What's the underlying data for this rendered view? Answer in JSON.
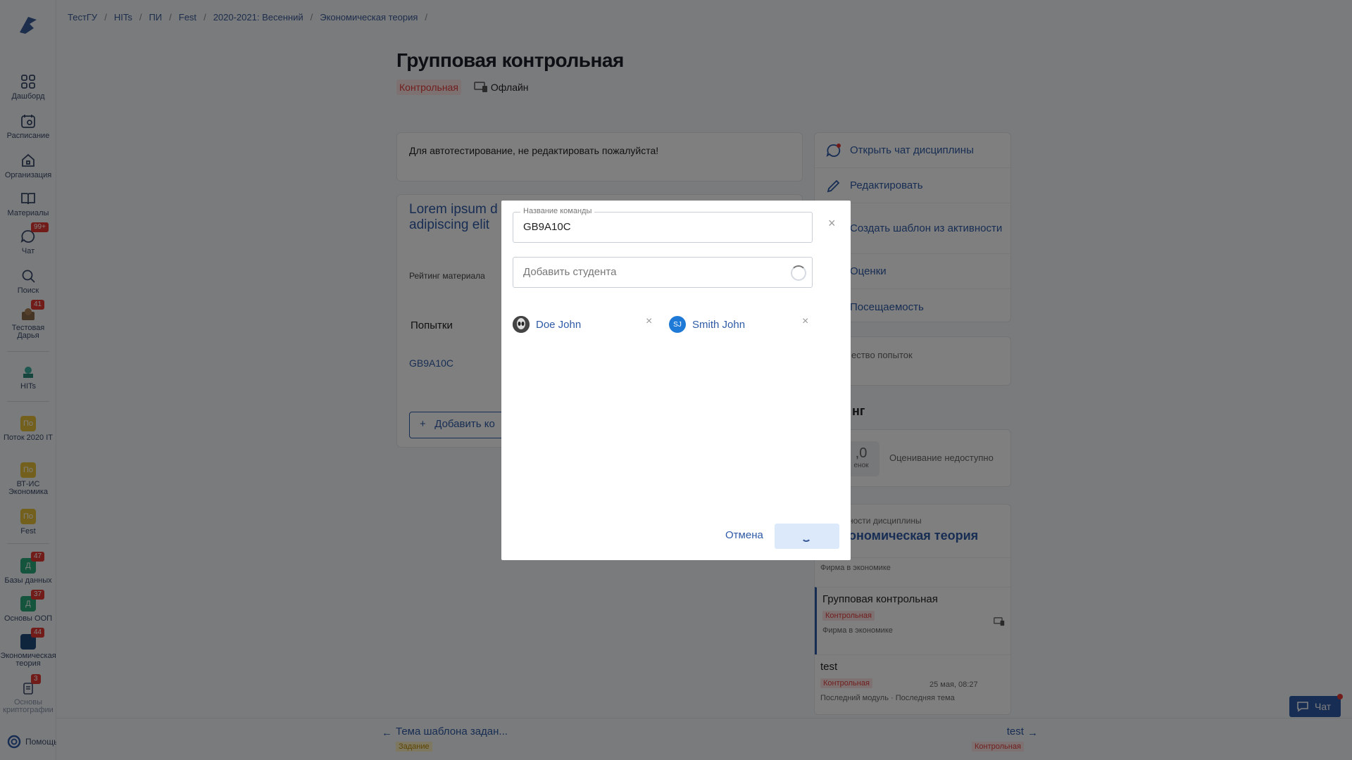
{
  "breadcrumbs": [
    "ТестГУ",
    "HITs",
    "ПИ",
    "Fest",
    "2020-2021: Весенний",
    "Экономическая теория"
  ],
  "sidebar": {
    "items": [
      {
        "label": "Дашборд",
        "icon": "dashboard-icon"
      },
      {
        "label": "Расписание",
        "icon": "calendar-icon"
      },
      {
        "label": "Организация",
        "icon": "home-icon"
      },
      {
        "label": "Материалы",
        "icon": "book-icon"
      },
      {
        "label": "Чат",
        "icon": "chat-icon",
        "badge": "99+"
      },
      {
        "label": "Поиск",
        "icon": "search-icon"
      },
      {
        "label": "Тестовая Дарья",
        "icon": "avatar-icon",
        "badge": "41"
      },
      {
        "label": "HITs",
        "icon": "org-logo-icon"
      },
      {
        "label": "Поток 2020 IT",
        "short": "По"
      },
      {
        "label": "ВТ-ИС Экономика",
        "short": "По"
      },
      {
        "label": "Fest",
        "short": "По"
      },
      {
        "label": "Базы данных",
        "short": "Д",
        "badge": "47"
      },
      {
        "label": "Основы ООП",
        "short": "Д",
        "badge": "37"
      },
      {
        "label": "Экономическая теория",
        "badge": "44"
      },
      {
        "label": "Основы криптографии",
        "badge": "3"
      }
    ],
    "help_label": "Помощь"
  },
  "page": {
    "title": "Групповая контрольная",
    "type_tag": "Контрольная",
    "mode_label": "Офлайн",
    "description": "Для автотестирование, не редактировать пожалуйста!",
    "lorem": "Lorem ipsum d",
    "lorem2": "adipiscing elit",
    "rating_label": "Рейтинг материала",
    "attempts_header": "Попытки",
    "team_link": "GB9A10C",
    "add_button": "Добавить ко"
  },
  "right_menu": [
    {
      "label": "Открыть чат дисциплины",
      "icon": "chat-icon"
    },
    {
      "label": "Редактировать",
      "icon": "pencil-icon"
    },
    {
      "label": "Создать шаблон из активности",
      "icon": "template-icon"
    },
    {
      "label": "Оценки",
      "icon": "grades-icon"
    },
    {
      "label": "Посещаемость",
      "icon": "attendance-icon"
    }
  ],
  "attempts_card": "ество попыток",
  "rating_title": "нг",
  "rating_value": ",0",
  "rating_small": "енок",
  "rating_na": "Оценивание недоступно",
  "discipline": {
    "sub": "ности дисциплины",
    "name": "ономическая теория",
    "rows": [
      {
        "sub": "Фирма в экономике"
      },
      {
        "title": "Групповая контрольная",
        "tag": "Контрольная",
        "sub": "Фирма в экономике"
      },
      {
        "title": "test",
        "tag": "Контрольная",
        "date": "25 мая, 08:27",
        "sub": "Последний модуль · Последняя тема"
      }
    ]
  },
  "bottom_nav": {
    "prev_title": "Тема шаблона задан...",
    "prev_tag": "Задание",
    "next_title": "test",
    "next_tag": "Контрольная"
  },
  "chat_fab": "Чат",
  "modal": {
    "team_name_label": "Название команды",
    "team_name_value": "GB9A10C",
    "add_student_placeholder": "Добавить студента",
    "students": [
      {
        "name": "Doe John",
        "initials": ""
      },
      {
        "name": "Smith John",
        "initials": "SJ"
      }
    ],
    "cancel_label": "Отмена",
    "close_glyph": "×"
  },
  "colors": {
    "accent": "#2e5aa6",
    "danger": "#e03c3c",
    "overlay": "rgba(0,0,0,0.5)"
  }
}
